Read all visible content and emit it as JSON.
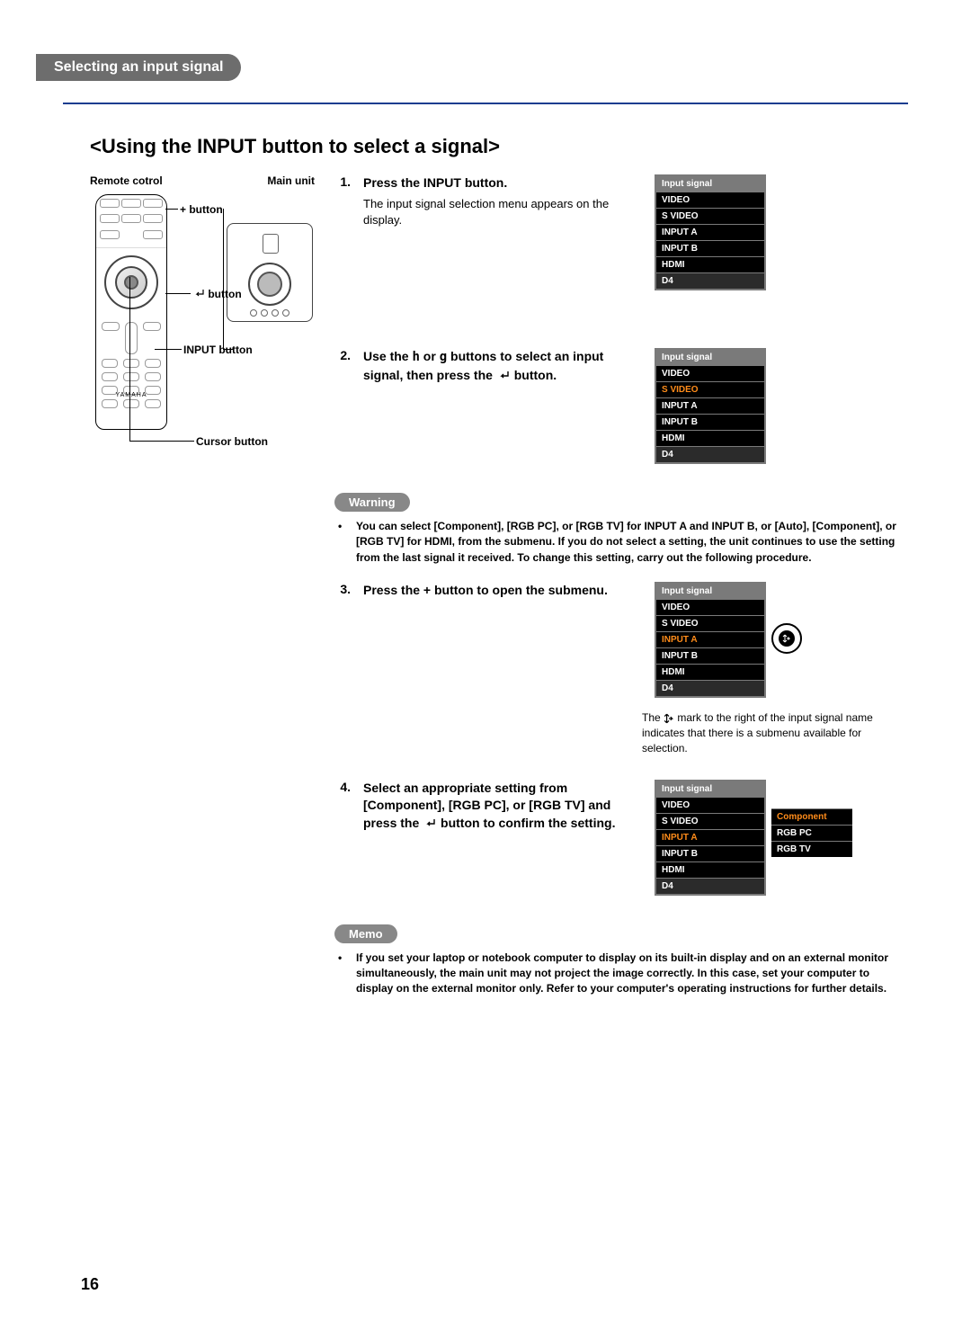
{
  "section": "Selecting an input signal",
  "heading": "<Using the INPUT button to select a signal>",
  "diagram": {
    "remote_label": "Remote cotrol",
    "main_unit_label": "Main unit",
    "plus_button": "+ button",
    "enter_button_hint": "button",
    "input_button": "INPUT button",
    "cursor_button": "Cursor button",
    "logo": "YAMAHA"
  },
  "steps": {
    "s1": {
      "num": "1.",
      "title": "Press the INPUT button.",
      "desc": "The input signal selection menu appears on the display."
    },
    "s2": {
      "num": "2.",
      "title_pre": "Use the ",
      "h": "h",
      "mid": " or ",
      "g": "g",
      "title_post": " buttons to select an input signal, then press the ",
      "button_word": "button."
    },
    "s3": {
      "num": "3.",
      "title": "Press the + button to open the submenu."
    },
    "s4": {
      "num": "4.",
      "title_pre": "Select an appropriate setting from  [Component], [RGB PC], or [RGB TV] and press the ",
      "title_post": " button to confirm the setting."
    }
  },
  "tables": {
    "header": "Input signal",
    "rows": [
      "VIDEO",
      "S VIDEO",
      "INPUT A",
      "INPUT B",
      "HDMI",
      "D4"
    ],
    "submenu": [
      "Component",
      "RGB PC",
      "RGB TV"
    ]
  },
  "warning": {
    "label": "Warning",
    "bullet": "•",
    "text": "You can select [Component], [RGB PC], or [RGB TV] for INPUT A and INPUT B, or [Auto], [Component], or [RGB TV] for HDMI, from the submenu. If you do not select a setting, the unit continues to use the setting from the last signal it received. To change this setting, carry out the following procedure."
  },
  "submenu_note": {
    "pre": "The ",
    "post": " mark to the right of the input signal name indicates that there is a submenu available for selection."
  },
  "memo": {
    "label": "Memo",
    "bullet": "•",
    "text": "If you set your laptop or notebook computer to display on its built-in display and on an external monitor simultaneously, the main unit may not project the image correctly. In this case, set your computer to display on the external monitor only. Refer to your computer's operating instructions for further details."
  },
  "page_number": "16"
}
